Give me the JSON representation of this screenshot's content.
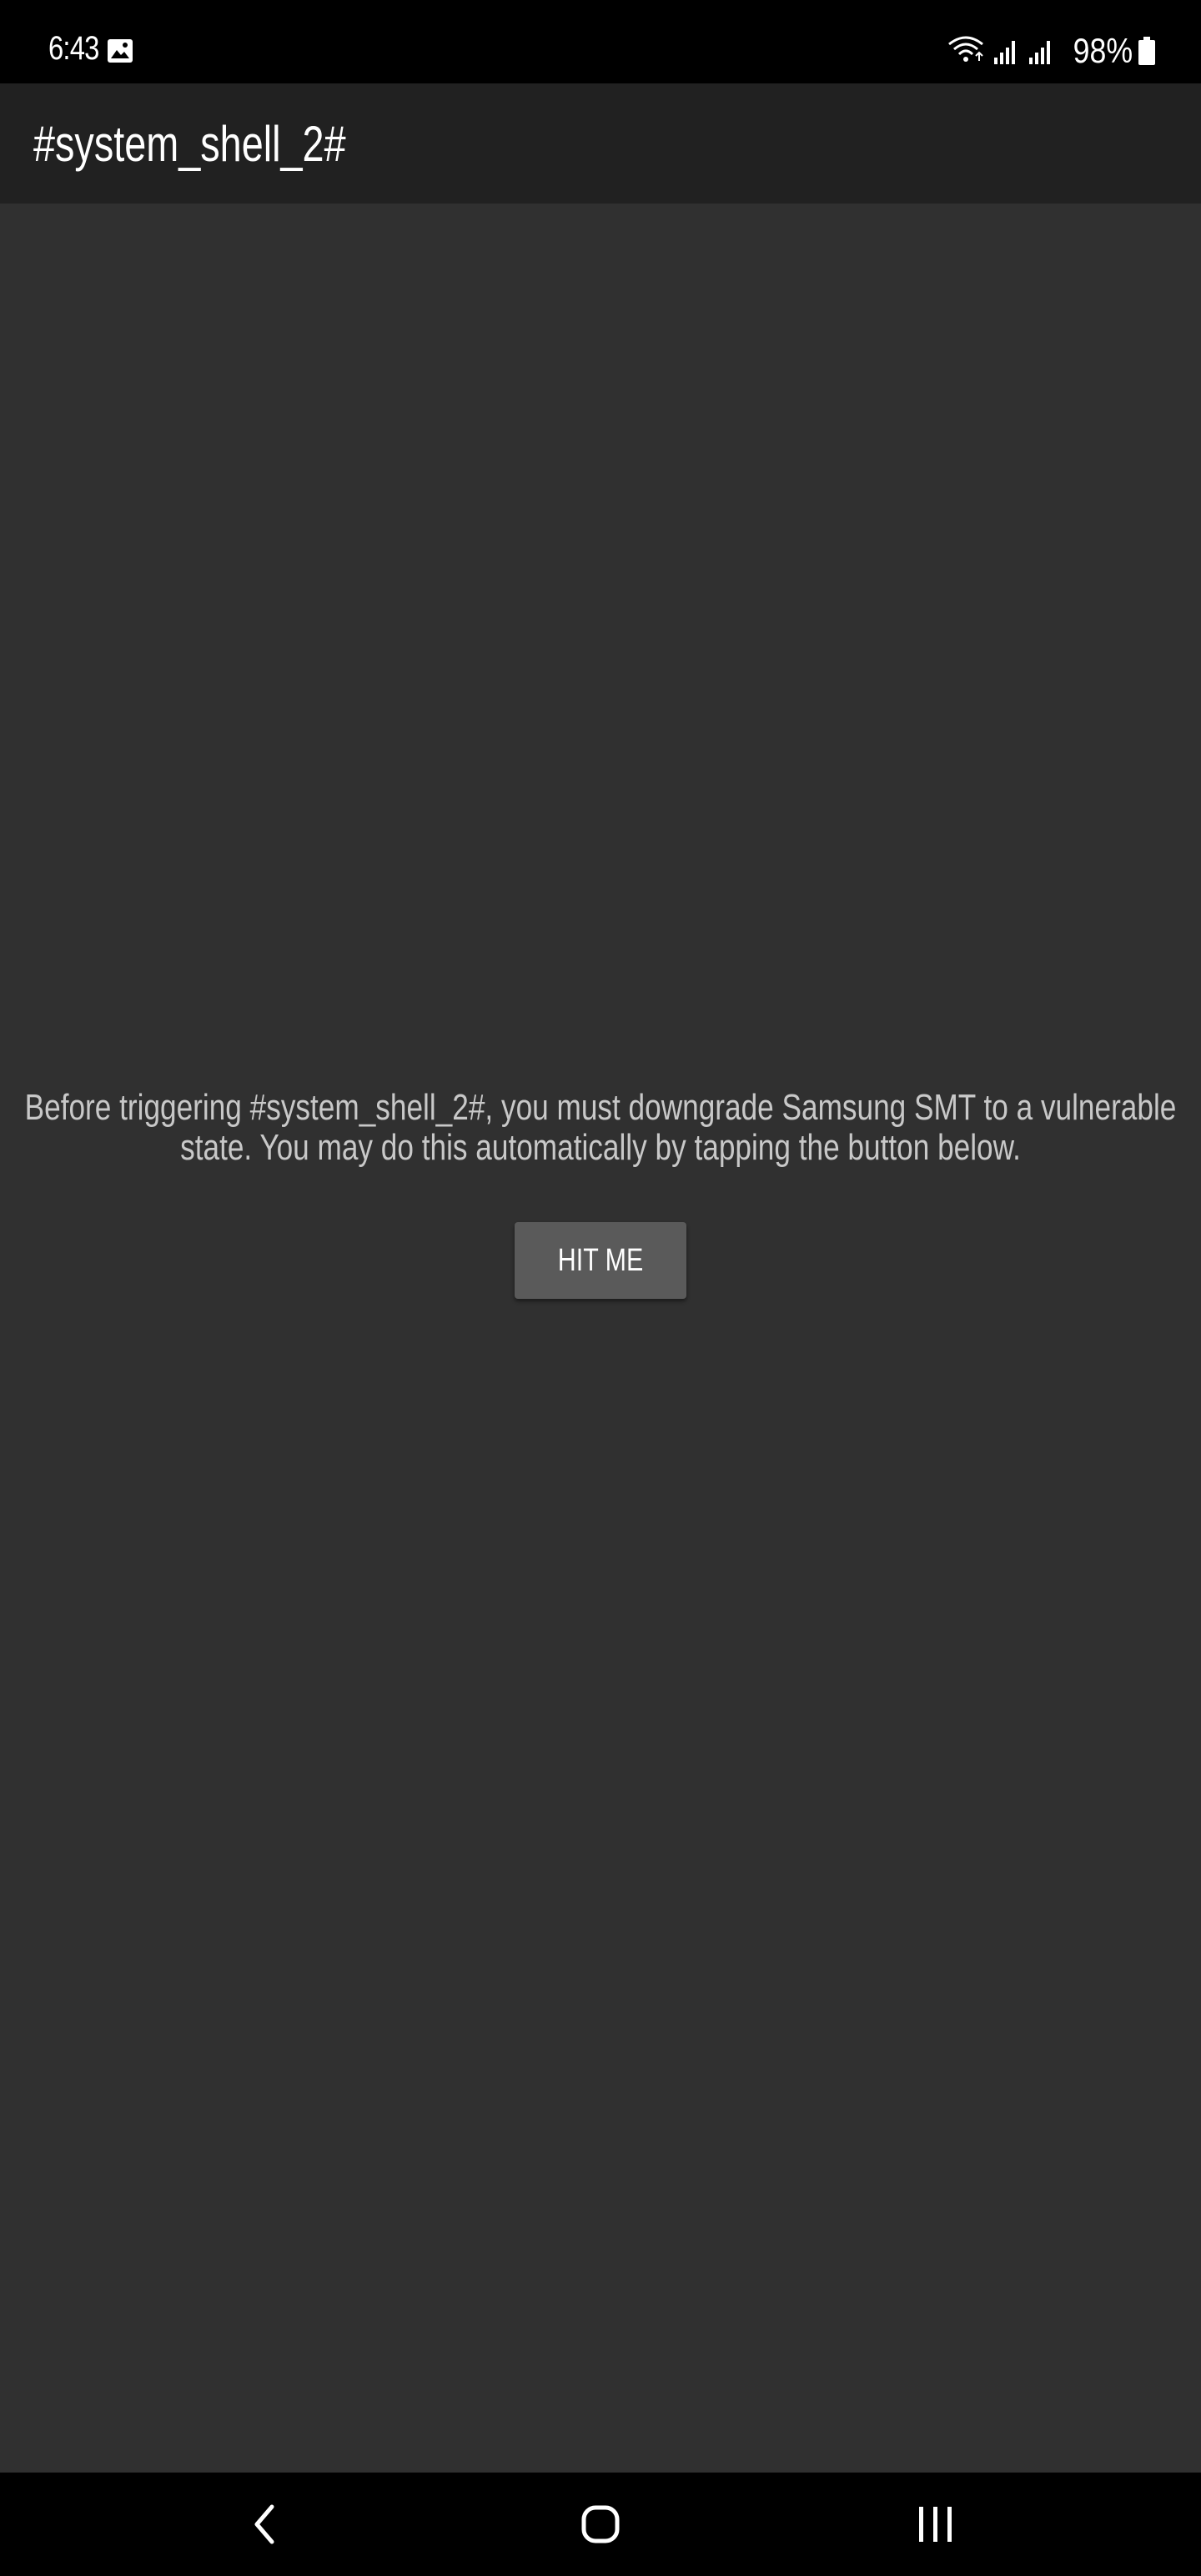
{
  "status_bar": {
    "time": "6:43",
    "battery": "98%",
    "icons": [
      "image-icon",
      "wifi-icon",
      "signal-icon",
      "signal-icon",
      "battery-icon"
    ]
  },
  "app_bar": {
    "title": "#system_shell_2#"
  },
  "main": {
    "message": "Before triggering #system_shell_2#, you must downgrade Samsung SMT to a vulnerable state. You may do this automatically by tapping the button below.",
    "button_label": "HIT ME"
  },
  "nav_bar": {
    "icons": [
      "back-icon",
      "home-icon",
      "recents-icon"
    ]
  },
  "colors": {
    "background": "#303030",
    "app_bar": "#212121",
    "button": "#5a5a5a",
    "text": "#c8c8c8"
  }
}
